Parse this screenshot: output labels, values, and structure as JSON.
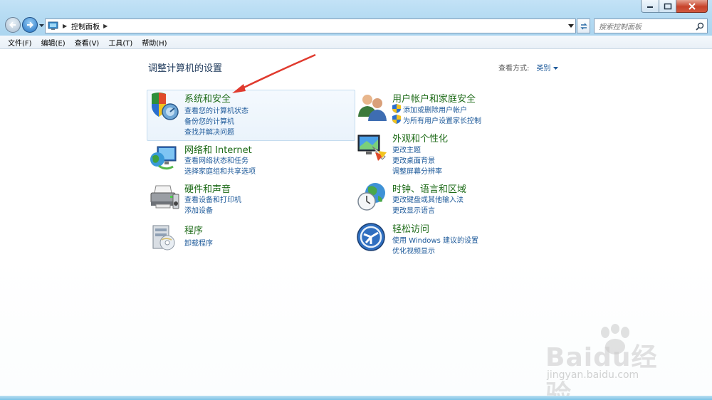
{
  "window": {
    "address_crumb": "控制面板",
    "search_placeholder": "搜索控制面板"
  },
  "menu": [
    "文件(F)",
    "编辑(E)",
    "查看(V)",
    "工具(T)",
    "帮助(H)"
  ],
  "page": {
    "title": "调整计算机的设置",
    "view_by_label": "查看方式:",
    "view_by_value": "类别"
  },
  "categories": [
    {
      "title": "系统和安全",
      "icon": "shield-computer-icon",
      "links": [
        "查看您的计算机状态",
        "备份您的计算机",
        "查找并解决问题"
      ]
    },
    {
      "title": "网络和 Internet",
      "icon": "network-globe-icon",
      "links": [
        "查看网络状态和任务",
        "选择家庭组和共享选项"
      ]
    },
    {
      "title": "硬件和声音",
      "icon": "printer-icon",
      "links": [
        "查看设备和打印机",
        "添加设备"
      ]
    },
    {
      "title": "程序",
      "icon": "programs-disc-icon",
      "links": [
        "卸载程序"
      ]
    },
    {
      "title": "用户帐户和家庭安全",
      "icon": "users-icon",
      "links": [
        "添加或删除用户帐户",
        "为所有用户设置家长控制"
      ]
    },
    {
      "title": "外观和个性化",
      "icon": "monitor-palette-icon",
      "links": [
        "更改主题",
        "更改桌面背景",
        "调整屏幕分辨率"
      ]
    },
    {
      "title": "时钟、语言和区域",
      "icon": "clock-globe-icon",
      "links": [
        "更改键盘或其他输入法",
        "更改显示语言"
      ]
    },
    {
      "title": "轻松访问",
      "icon": "ease-of-access-icon",
      "links": [
        "使用 Windows 建议的设置",
        "优化视频显示"
      ]
    }
  ],
  "watermark": {
    "brand": "Baidu经验",
    "url": "jingyan.baidu.com"
  },
  "colors": {
    "category_title": "#1e6b18",
    "link": "#1e5a9a",
    "arrow": "#e03a2e"
  }
}
